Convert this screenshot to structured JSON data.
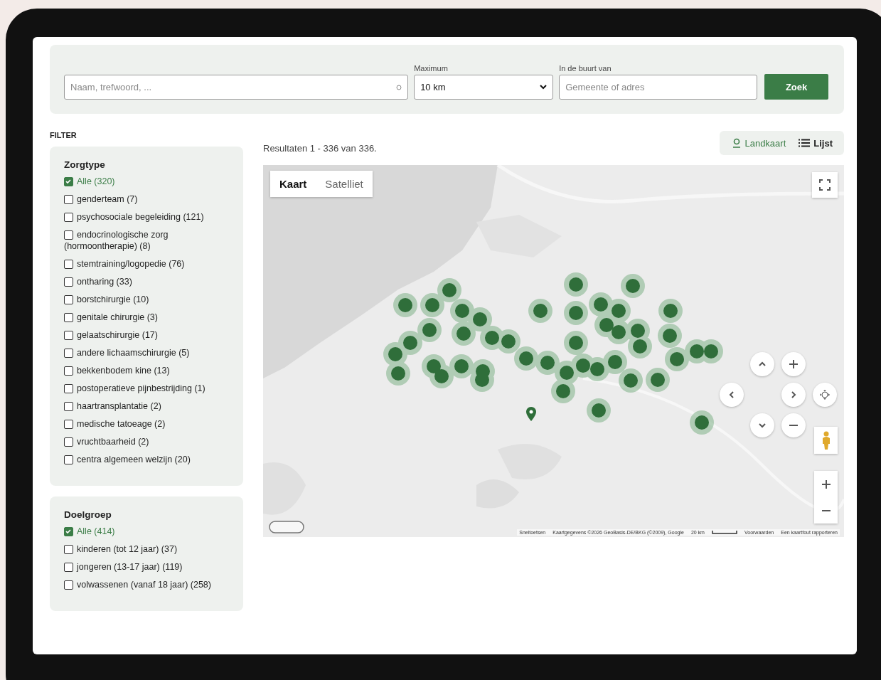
{
  "search": {
    "keyword_placeholder": "Naam, trefwoord, ...",
    "max_label": "Maximum",
    "max_value": "10 km",
    "near_label": "In de buurt van",
    "near_placeholder": "Gemeente of adres",
    "button": "Zoek"
  },
  "filter_title": "FILTER",
  "filter_groups": [
    {
      "title": "Zorgtype",
      "options": [
        {
          "label": "Alle (320)",
          "checked": true
        },
        {
          "label": "genderteam (7)",
          "checked": false
        },
        {
          "label": "psychosociale begeleiding (121)",
          "checked": false
        },
        {
          "label": "endocrinologische zorg (hormoontherapie) (8)",
          "checked": false
        },
        {
          "label": "stemtraining/logopedie (76)",
          "checked": false
        },
        {
          "label": "ontharing (33)",
          "checked": false
        },
        {
          "label": "borstchirurgie (10)",
          "checked": false
        },
        {
          "label": "genitale chirurgie (3)",
          "checked": false
        },
        {
          "label": "gelaatschirurgie (17)",
          "checked": false
        },
        {
          "label": "andere lichaamschirurgie (5)",
          "checked": false
        },
        {
          "label": "bekkenbodem kine (13)",
          "checked": false
        },
        {
          "label": "postoperatieve pijnbestrijding (1)",
          "checked": false
        },
        {
          "label": "haartransplantatie (2)",
          "checked": false
        },
        {
          "label": "medische tatoeage (2)",
          "checked": false
        },
        {
          "label": "vruchtbaarheid (2)",
          "checked": false
        },
        {
          "label": "centra algemeen welzijn (20)",
          "checked": false
        }
      ]
    },
    {
      "title": "Doelgroep",
      "options": [
        {
          "label": "Alle (414)",
          "checked": true
        },
        {
          "label": "kinderen (tot 12 jaar) (37)",
          "checked": false
        },
        {
          "label": "jongeren (13-17 jaar) (119)",
          "checked": false
        },
        {
          "label": "volwassenen (vanaf 18 jaar) (258)",
          "checked": false
        }
      ]
    }
  ],
  "results_text": "Resultaten 1 - 336 van 336.",
  "view_toggle": [
    {
      "label": "Landkaart",
      "kind": "pin",
      "selected": true
    },
    {
      "label": "Lijst",
      "kind": "list",
      "selected": false
    }
  ],
  "map": {
    "type_tabs": [
      {
        "label": "Kaart",
        "selected": true
      },
      {
        "label": "Satelliet",
        "selected": false
      }
    ],
    "attribution": [
      "Sneltoetsen",
      "Kaartgegevens ©2026 GeoBasis-DE/BKG (©2009), Google",
      "20 km",
      "Voorwaarden",
      "Een kaartfout rapporteren"
    ]
  }
}
